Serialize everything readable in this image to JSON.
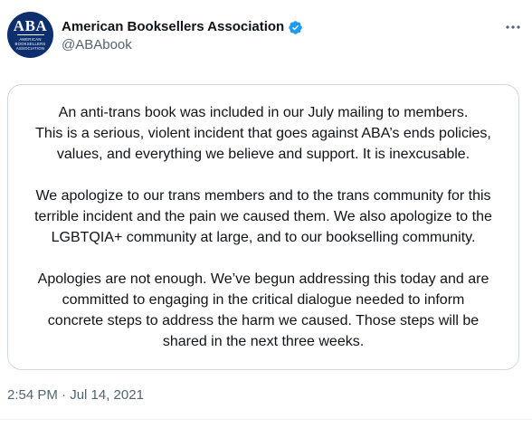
{
  "author": {
    "display_name": "American Booksellers Association",
    "handle": "@ABAbook",
    "avatar_logo_text": "ABA",
    "avatar_sub_text": "AMERICAN BOOKSELLERS ASSOCIATION",
    "verified": true
  },
  "menu_icon": "more-horizontal-icon",
  "statement": {
    "paragraphs": [
      [
        "An anti-trans book was included in our July mailing to members.",
        "This is a serious, violent incident that goes against ABA’s ends policies,",
        "values, and everything we believe and support. It is inexcusable."
      ],
      [
        "We apologize to our trans members and to the trans community for this",
        "terrible incident and the pain we caused them. We also apologize to the",
        "LGBTQIA+ community at large, and to our bookselling community."
      ],
      [
        "Apologies are not enough. We’ve begun addressing this today and are",
        "committed to engaging in the critical dialogue needed to inform",
        "concrete steps to address the harm we caused. Those steps will be",
        "shared in the next three weeks."
      ]
    ]
  },
  "timestamp": "2:54 PM · Jul 14, 2021",
  "colors": {
    "text": "#0f1419",
    "secondary": "#536471",
    "verified": "#1d9bf0",
    "avatar_bg": "#0d2f6e",
    "border": "#cfd9de"
  }
}
